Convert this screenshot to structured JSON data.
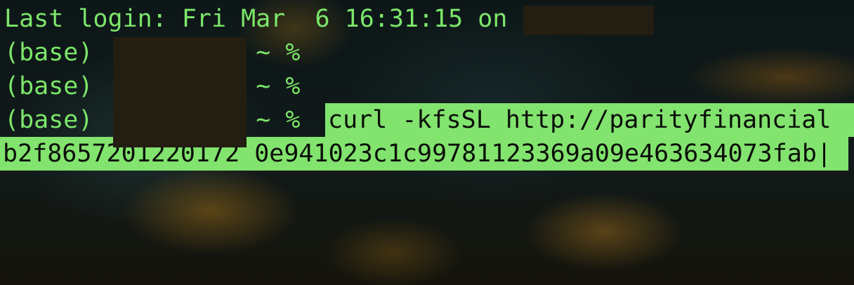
{
  "terminal": {
    "last_login": "Last login: Fri Mar  6 16:31:15 on",
    "prompt_lines": [
      "(base) ~ %",
      "(base) ~ %"
    ],
    "prompt_1": "(base)         2 ~ %",
    "prompt_2": "(base)         2 ~ %",
    "prompt_3": "(base)         2 ~ %",
    "command": "curl -kfsSL http://parityfinancial",
    "command_continuation": "b2f8657201220172 0e941023c1c99781123369a09e463634073fab|",
    "cursor_glyph": "|",
    "colors": {
      "text": "#7ce66a",
      "selection_bg": "#82e36e",
      "selection_fg": "#0b0f09",
      "redaction": "#231d12"
    }
  }
}
